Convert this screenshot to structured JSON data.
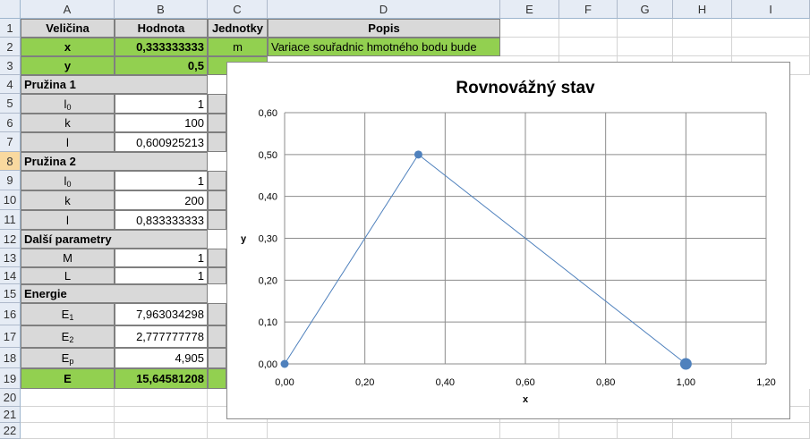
{
  "columns": [
    "A",
    "B",
    "C",
    "D",
    "E",
    "F",
    "G",
    "H",
    "I"
  ],
  "rows": [
    "1",
    "2",
    "3",
    "4",
    "5",
    "6",
    "7",
    "8",
    "9",
    "10",
    "11",
    "12",
    "13",
    "14",
    "15",
    "16",
    "17",
    "18",
    "19",
    "20",
    "21",
    "22"
  ],
  "header": {
    "a": "Veličina",
    "b": "Hodnota",
    "c": "Jednotky",
    "d": "Popis"
  },
  "r2": {
    "a": "x",
    "b": "0,333333333",
    "c": "m",
    "d": "Variace souřadnic hmotného bodu bude"
  },
  "r3": {
    "a": "y",
    "b": "0,5"
  },
  "r4": {
    "a": "Pružina 1"
  },
  "r5": {
    "a": "l",
    "sub": "0",
    "b": "1"
  },
  "r6": {
    "a": "k",
    "b": "100"
  },
  "r7": {
    "a": "l",
    "b": "0,600925213"
  },
  "r8": {
    "a": "Pružina 2"
  },
  "r9": {
    "a": "l",
    "sub": "0",
    "b": "1"
  },
  "r10": {
    "a": "k",
    "b": "200"
  },
  "r11": {
    "a": "l",
    "b": "0,833333333"
  },
  "r12": {
    "a": "Další parametry"
  },
  "r13": {
    "a": "M",
    "b": "1"
  },
  "r14": {
    "a": "L",
    "b": "1"
  },
  "r15": {
    "a": "Energie"
  },
  "r16": {
    "a": "E",
    "sub": "1",
    "b": "7,963034298"
  },
  "r17": {
    "a": "E",
    "sub": "2",
    "b": "2,777777778"
  },
  "r18": {
    "a": "E",
    "sub": "p",
    "b": "4,905"
  },
  "r19": {
    "a": "E",
    "b": "15,64581208"
  },
  "chart_data": {
    "type": "scatter",
    "title": "Rovnovážný stav",
    "xlabel": "x",
    "ylabel": "y",
    "xlim": [
      0,
      1.2
    ],
    "ylim": [
      0,
      0.6
    ],
    "xticks": [
      "0,00",
      "0,20",
      "0,40",
      "0,60",
      "0,80",
      "1,00",
      "1,20"
    ],
    "yticks": [
      "0,00",
      "0,10",
      "0,20",
      "0,30",
      "0,40",
      "0,50",
      "0,60"
    ],
    "grid": true,
    "series": [
      {
        "x": [
          0,
          0.333333333,
          1
        ],
        "y": [
          0,
          0.5,
          0
        ],
        "color": "#4f81bd"
      }
    ]
  }
}
